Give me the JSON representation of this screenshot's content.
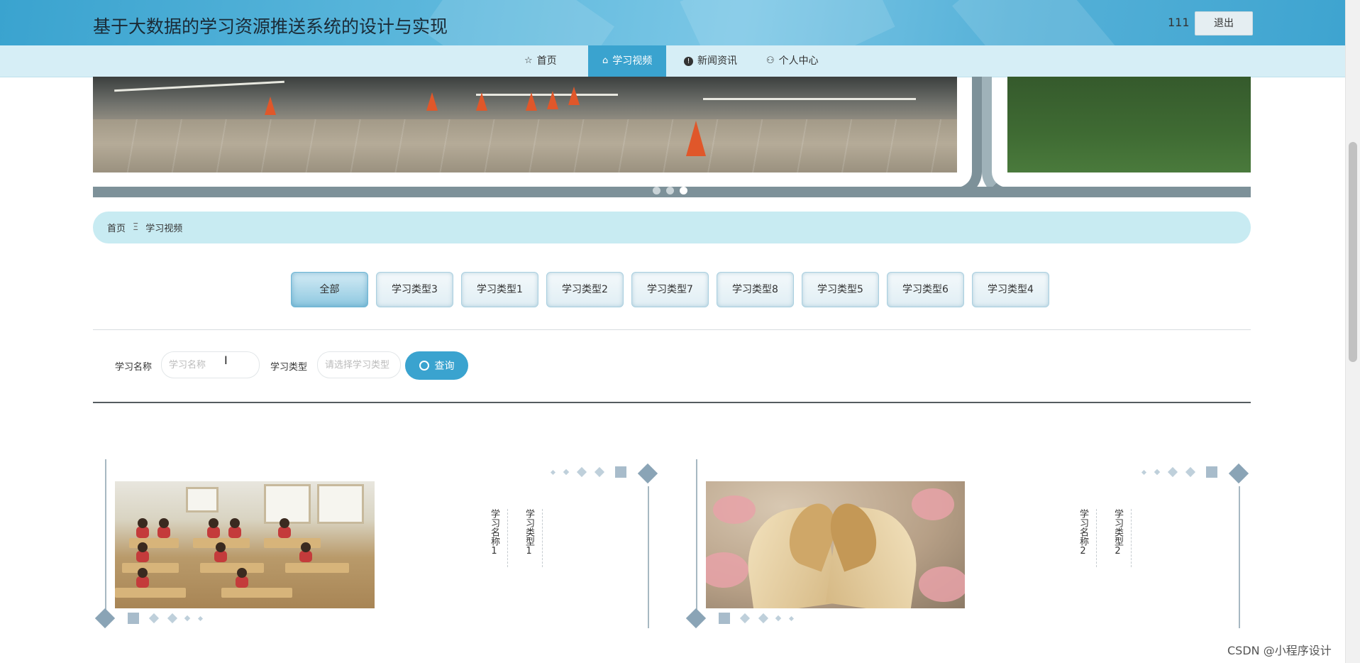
{
  "header": {
    "site_title": "基于大数据的学习资源推送系统的设计与实现",
    "username": "111",
    "logout_label": "退出"
  },
  "nav": {
    "items": [
      {
        "label": "首页",
        "icon": "star-icon"
      },
      {
        "label": "学习视频",
        "icon": "bag-icon",
        "active": true
      },
      {
        "label": "新闻资讯",
        "icon": "info-icon"
      },
      {
        "label": "个人中心",
        "icon": "user-icon"
      }
    ]
  },
  "carousel": {
    "slide_count": 3,
    "active_index": 2
  },
  "breadcrumb": {
    "home": "首页",
    "separator": "Ξ",
    "current": "学习视频"
  },
  "categories": {
    "items": [
      "全部",
      "学习类型3",
      "学习类型1",
      "学习类型2",
      "学习类型7",
      "学习类型8",
      "学习类型5",
      "学习类型6",
      "学习类型4"
    ],
    "active": "全部"
  },
  "search": {
    "name_label": "学习名称",
    "name_placeholder": "学习名称",
    "type_label": "学习类型",
    "type_placeholder": "请选择学习类型",
    "button_label": "查询"
  },
  "cards": [
    {
      "name": "学习名称1",
      "type": "学习类型1",
      "image": "classroom"
    },
    {
      "name": "学习名称2",
      "type": "学习类型2",
      "image": "open-book"
    }
  ],
  "watermark": "CSDN @小程序设计",
  "colors": {
    "accent": "#3aa3cf",
    "nav_bg": "#d6eef6",
    "breadcrumb_bg": "#c8ebf2"
  }
}
